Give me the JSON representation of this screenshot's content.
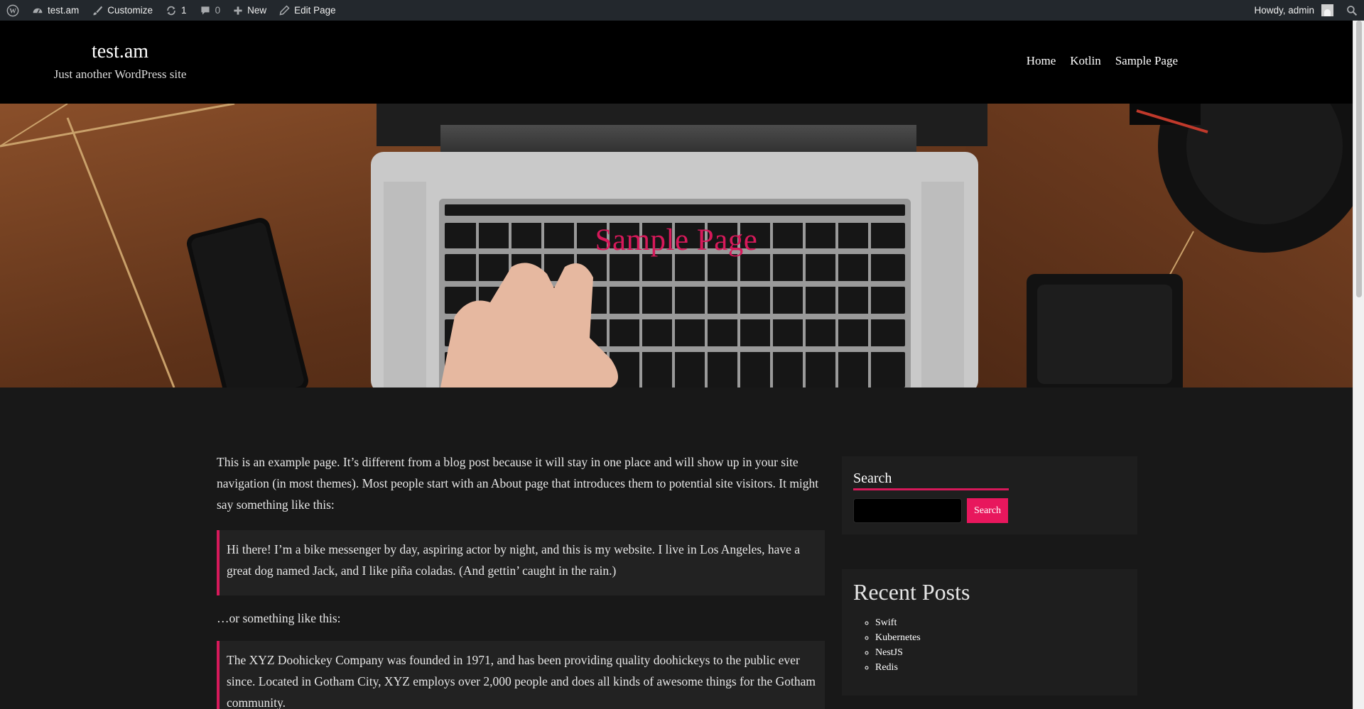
{
  "admin_bar": {
    "site_name": "test.am",
    "customize": "Customize",
    "updates_count": "1",
    "comments_count": "0",
    "new": "New",
    "edit_page": "Edit Page",
    "howdy": "Howdy, admin"
  },
  "header": {
    "site_title": "test.am",
    "tagline": "Just another WordPress site",
    "nav": [
      "Home",
      "Kotlin",
      "Sample Page"
    ]
  },
  "hero": {
    "title": "Sample Page"
  },
  "content": {
    "para1": "This is an example page. It’s different from a blog post because it will stay in one place and will show up in your site navigation (in most themes). Most people start with an About page that introduces them to potential site visitors. It might say something like this:",
    "quote1": "Hi there! I’m a bike messenger by day, aspiring actor by night, and this is my website. I live in Los Angeles, have a great dog named Jack, and I like piña coladas. (And gettin’ caught in the rain.)",
    "para2": "…or something like this:",
    "quote2": "The XYZ Doohickey Company was founded in 1971, and has been providing quality doohickeys to the public ever since. Located in Gotham City, XYZ employs over 2,000 people and does all kinds of awesome things for the Gotham community."
  },
  "sidebar": {
    "search": {
      "heading": "Search",
      "button": "Search",
      "placeholder": ""
    },
    "recent_posts": {
      "heading": "Recent Posts",
      "items": [
        "Swift",
        "Kubernetes",
        "NestJS",
        "Redis"
      ]
    }
  },
  "colors": {
    "accent": "#e8175d",
    "admin_bar": "#23282d",
    "header": "#000000",
    "body": "#181818"
  },
  "icons": {
    "wp_logo": "wordpress-icon",
    "site": "dashboard-icon",
    "customize": "brush-icon",
    "updates": "refresh-icon",
    "comments": "comment-icon",
    "new": "plus-icon",
    "edit": "pencil-icon",
    "search": "search-icon"
  }
}
